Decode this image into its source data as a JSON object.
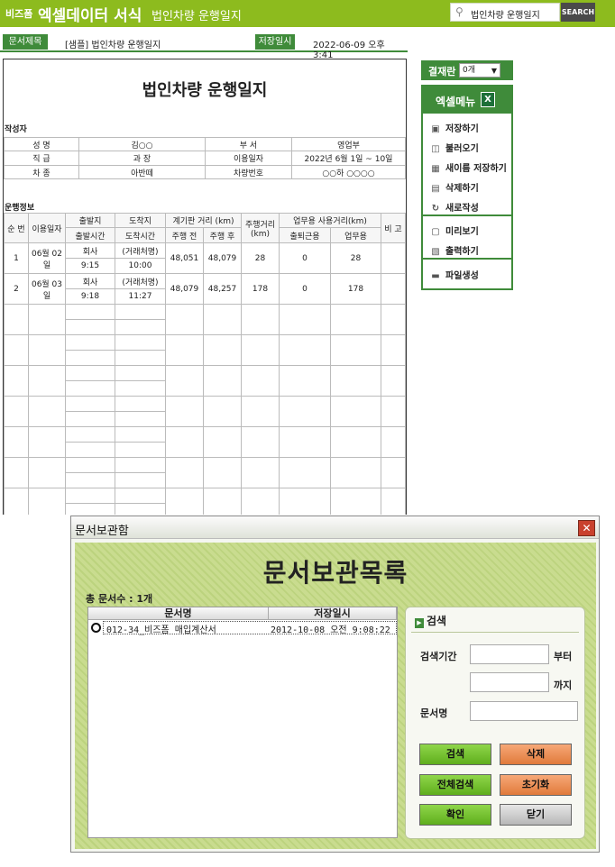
{
  "topbar": {
    "brand_small": "비즈폼",
    "brand": "엑셀데이터 서식",
    "subtitle": "법인차량 운행일지",
    "search_value": "법인차량 운행일지",
    "search_button": "SEARCH"
  },
  "infobar": {
    "doc_title_label": "문서제목",
    "doc_title": "[샘플] 법인차량 운행일지",
    "save_date_label": "저장일시",
    "save_date": "2022-06-09  오후 3:41"
  },
  "doc": {
    "title": "법인차량 운행일지",
    "writer_section": "작성자",
    "writer": {
      "name_label": "성    명",
      "name": "김○○",
      "dept_label": "부    서",
      "dept": "영업부",
      "rank_label": "직    급",
      "rank": "과    장",
      "period_label": "이용일자",
      "period": "2022년 6월 1일 ~ 10일",
      "cartype_label": "차    종",
      "cartype": "아반떼",
      "carno_label": "차량번호",
      "carno": "○○하 ○○○○"
    },
    "drive_section": "운행정보",
    "headers": {
      "no": "순 번",
      "date": "이용일자",
      "dep": "출발지",
      "arr": "도착지",
      "gauge": "계기판 거리 (km)",
      "dist": "주행거리\n(km)",
      "biz": "업무용 사용거리(km)",
      "note": "비 고",
      "dep_time": "출발시간",
      "arr_time": "도착시간",
      "before": "주행 전",
      "after": "주행 후",
      "commute": "출퇴근용",
      "work": "업무용"
    },
    "rows": [
      {
        "no": "1",
        "date": "06월 02일",
        "dep": "회사",
        "arr": "(거래처명)",
        "dep_time": "9:15",
        "arr_time": "10:00",
        "before": "48,051",
        "after": "48,079",
        "dist": "28",
        "commute": "0",
        "work": "28"
      },
      {
        "no": "2",
        "date": "06월 03일",
        "dep": "회사",
        "arr": "(거래처명)",
        "dep_time": "9:18",
        "arr_time": "11:27",
        "before": "48,079",
        "after": "48,257",
        "dist": "178",
        "commute": "0",
        "work": "178"
      }
    ]
  },
  "side": {
    "approval_label": "결재란",
    "approval_value": "0개",
    "menu_title": "엑셀메뉴",
    "items": [
      "저장하기",
      "불러오기",
      "새이름 저장하기",
      "삭제하기",
      "새로작성",
      "미리보기",
      "출력하기",
      "파일생성"
    ]
  },
  "dialog": {
    "window_title": "문서보관함",
    "heading": "문서보관목록",
    "count": "총 문서수 : 1개",
    "col_name": "문서명",
    "col_date": "저장일시",
    "list": [
      {
        "name": "012-34_비즈폼 매입계산서",
        "date": "2012-10-08 오전 9:08:22"
      }
    ],
    "search_title": "검색",
    "period_label": "검색기간",
    "from_label": "부터",
    "to_label": "까지",
    "docname_label": "문서명",
    "buttons": {
      "search": "검색",
      "delete": "삭제",
      "search_all": "전체검색",
      "reset": "초기화",
      "ok": "확인",
      "close": "닫기"
    }
  }
}
